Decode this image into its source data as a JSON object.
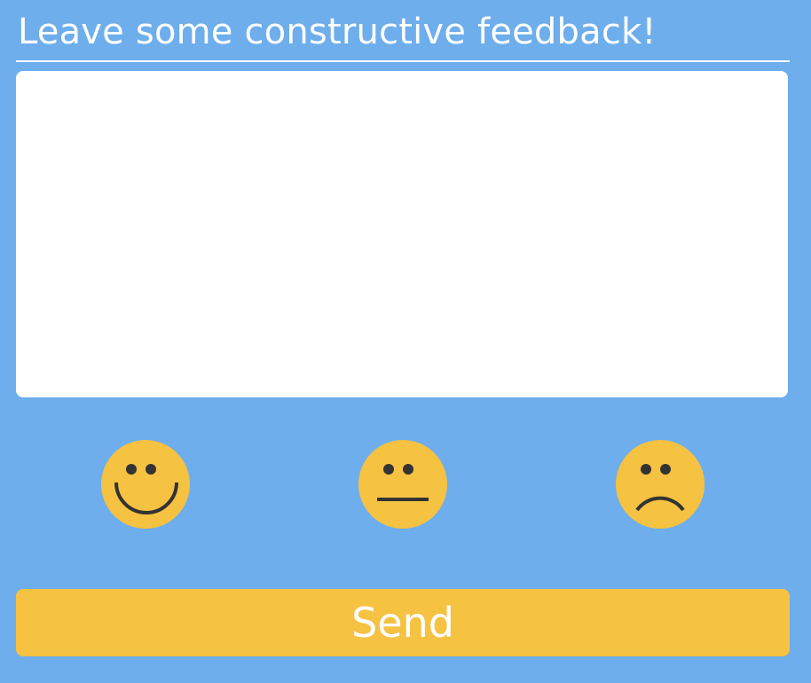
{
  "header": {
    "title": "Leave some constructive feedback!"
  },
  "feedback": {
    "value": "",
    "placeholder": ""
  },
  "ratings": [
    {
      "icon": "happy-face-icon",
      "color": "#f5c242"
    },
    {
      "icon": "neutral-face-icon",
      "color": "#f5c242"
    },
    {
      "icon": "sad-face-icon",
      "color": "#f5c242"
    }
  ],
  "actions": {
    "send_label": "Send"
  },
  "colors": {
    "background": "#6eaeec",
    "accent": "#f5c242",
    "panel": "#ffffff",
    "text_on_accent": "#ffffff",
    "face_features": "#333333"
  }
}
